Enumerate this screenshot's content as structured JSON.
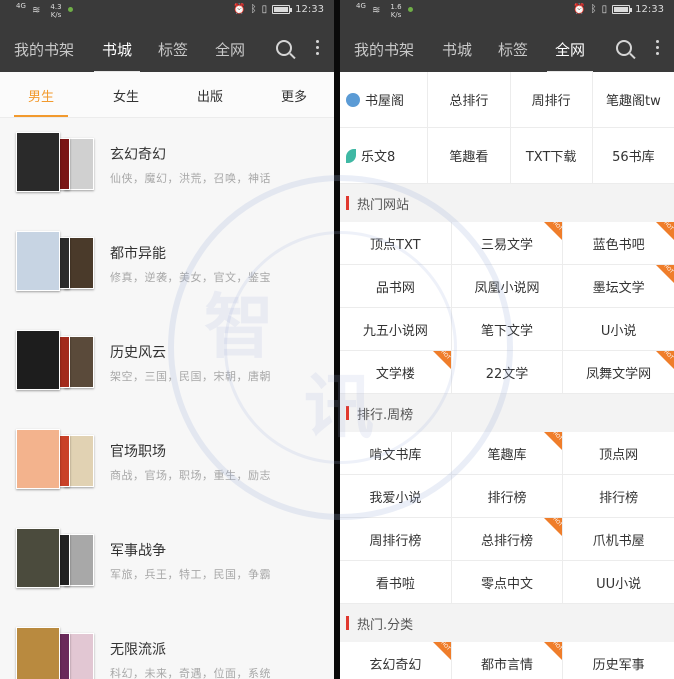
{
  "status": {
    "left_net": "4G",
    "left_speed": "4.3 K/s",
    "right_speed": "1.6 K/s",
    "time": "12:33"
  },
  "left": {
    "tabs": [
      {
        "label": "我的书架",
        "active": false
      },
      {
        "label": "书城",
        "active": true
      },
      {
        "label": "标签",
        "active": false
      },
      {
        "label": "全网",
        "active": false
      }
    ],
    "gender_tabs": [
      {
        "label": "男生",
        "active": true
      },
      {
        "label": "女生",
        "active": false
      },
      {
        "label": "出版",
        "active": false
      },
      {
        "label": "更多",
        "active": false
      }
    ],
    "categories": [
      {
        "title": "玄幻奇幻",
        "tags": "仙侠，魔幻，洪荒，召唤，神话",
        "covers": [
          "#2a2a2a",
          "#7a1515",
          "#d0d0d0"
        ]
      },
      {
        "title": "都市异能",
        "tags": "修真，逆袭，美女，官文，鉴宝",
        "covers": [
          "#c7d4e3",
          "#2b2b2b",
          "#4a3a2a"
        ]
      },
      {
        "title": "历史风云",
        "tags": "架空，三国，民国，宋朝，唐朝",
        "covers": [
          "#1d1d1d",
          "#a22a1c",
          "#5a4a3a"
        ]
      },
      {
        "title": "官场职场",
        "tags": "商战，官场，职场，重生，励志",
        "covers": [
          "#f3b38d",
          "#c94128",
          "#e1d2b3"
        ]
      },
      {
        "title": "军事战争",
        "tags": "军旅，兵王，特工，民国，争霸",
        "covers": [
          "#4b4b3d",
          "#222222",
          "#a8a8a8"
        ]
      },
      {
        "title": "无限流派",
        "tags": "科幻，未来，奇遇，位面，系统",
        "covers": [
          "#b98a3f",
          "#6a2a5a",
          "#e2c7d3"
        ]
      }
    ]
  },
  "right": {
    "tabs": [
      {
        "label": "我的书架",
        "active": false
      },
      {
        "label": "书城",
        "active": false
      },
      {
        "label": "标签",
        "active": false
      },
      {
        "label": "全网",
        "active": true
      }
    ],
    "site_rows": [
      [
        "书屋阁",
        "总排行",
        "周排行",
        "笔趣阁tw"
      ],
      [
        "乐文8",
        "笔趣看",
        "TXT下载",
        "56书库"
      ]
    ],
    "sections": [
      {
        "title": "热门网站",
        "rows": [
          [
            {
              "label": "顶点TXT",
              "hot": false
            },
            {
              "label": "三易文学",
              "hot": true
            },
            {
              "label": "蓝色书吧",
              "hot": true
            }
          ],
          [
            {
              "label": "品书网",
              "hot": false
            },
            {
              "label": "凤凰小说网",
              "hot": false
            },
            {
              "label": "墨坛文学",
              "hot": true
            }
          ],
          [
            {
              "label": "九五小说网",
              "hot": false
            },
            {
              "label": "笔下文学",
              "hot": false
            },
            {
              "label": "U小说",
              "hot": false
            }
          ],
          [
            {
              "label": "文学楼",
              "hot": true
            },
            {
              "label": "22文学",
              "hot": false
            },
            {
              "label": "凤舞文学网",
              "hot": true
            }
          ]
        ]
      },
      {
        "title": "排行.周榜",
        "rows": [
          [
            {
              "label": "啃文书库",
              "hot": false
            },
            {
              "label": "笔趣库",
              "hot": true
            },
            {
              "label": "顶点网",
              "hot": false
            }
          ],
          [
            {
              "label": "我爱小说",
              "hot": false
            },
            {
              "label": "排行榜",
              "hot": false
            },
            {
              "label": "排行榜",
              "hot": false
            }
          ],
          [
            {
              "label": "周排行榜",
              "hot": false
            },
            {
              "label": "总排行榜",
              "hot": true
            },
            {
              "label": "爪机书屋",
              "hot": false
            }
          ],
          [
            {
              "label": "看书啦",
              "hot": false
            },
            {
              "label": "零点中文",
              "hot": false
            },
            {
              "label": "UU小说",
              "hot": false
            }
          ]
        ]
      },
      {
        "title": "热门.分类",
        "rows": [
          [
            {
              "label": "玄幻奇幻",
              "hot": true
            },
            {
              "label": "都市言情",
              "hot": true
            },
            {
              "label": "历史军事",
              "hot": false
            }
          ]
        ]
      }
    ],
    "hot_badge_text": "HOT"
  },
  "watermark_text": [
    "智",
    "讯"
  ],
  "colors": {
    "accent": "#f29a2e",
    "appbar": "#3a3a3a",
    "section_bar": "#e0382f",
    "hot": "#ef7d2a"
  },
  "icons": {
    "search": "search-icon",
    "more": "more-vertical-icon",
    "alarm": "alarm-icon",
    "bluetooth": "bluetooth-icon",
    "vibrate": "vibrate-icon",
    "battery": "battery-icon",
    "wifi": "wifi-icon"
  },
  "battery_level": 0.85
}
